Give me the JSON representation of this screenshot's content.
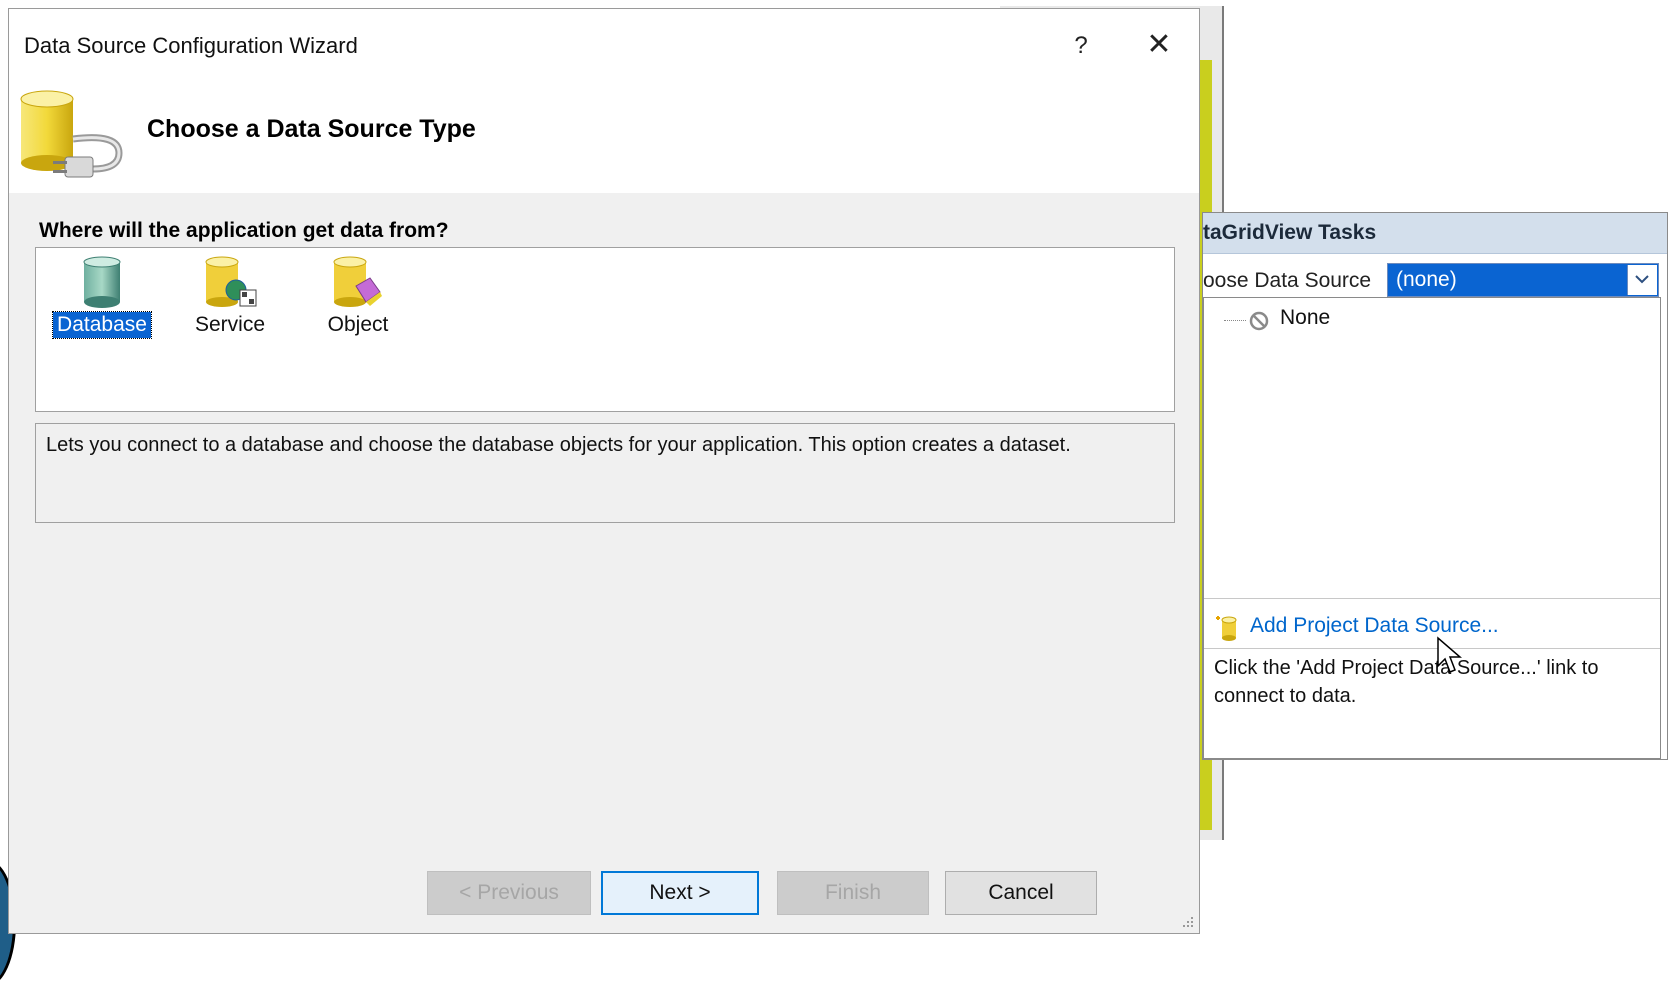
{
  "wizard": {
    "title": "Data Source Configuration Wizard",
    "help_label": "?",
    "close_label": "✕",
    "header_title": "Choose a Data Source Type",
    "question": "Where will the application get data from?",
    "types": [
      {
        "label": "Database",
        "icon": "database-icon",
        "selected": true
      },
      {
        "label": "Service",
        "icon": "service-icon",
        "selected": false
      },
      {
        "label": "Object",
        "icon": "object-icon",
        "selected": false
      }
    ],
    "description": "Lets you connect to a database and choose the database objects for your application. This option creates a dataset.",
    "buttons": {
      "previous": "< Previous",
      "next": "Next >",
      "finish": "Finish",
      "cancel": "Cancel"
    }
  },
  "tasks_panel": {
    "title": "taGridView Tasks",
    "choose_label": "oose Data Source",
    "selected_value": "(none)",
    "tree_items": [
      "None"
    ],
    "add_link": "Add Project Data Source...",
    "hint": "Click the 'Add Project Data Source...' link to connect to data."
  },
  "colors": {
    "selection": "#0a64d2",
    "link": "#0066cc",
    "header_bg": "#d3dfec"
  }
}
